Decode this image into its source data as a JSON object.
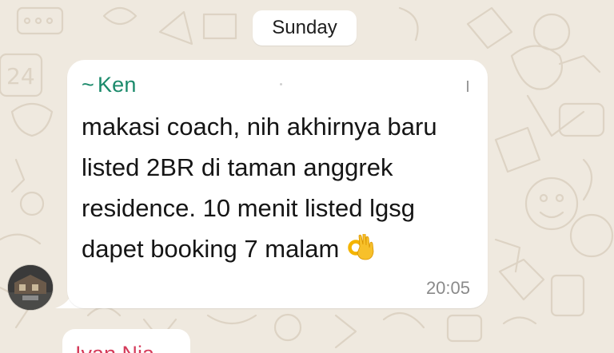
{
  "chat": {
    "date_separator": "Sunday",
    "colors": {
      "background": "#efe9df",
      "bubble": "#ffffff",
      "sender_name": "#1b8a6b",
      "next_sender_name": "#d43b5a",
      "timestamp": "#8a8a8a"
    },
    "message": {
      "sender_prefix": "~",
      "sender_name": "Ken",
      "lines": [
        "makasi coach, nih akhirnya baru",
        "listed 2BR di taman anggrek",
        "residence. 10 menit listed lgsg",
        "dapet booking 7 malam"
      ],
      "emoji": "ok-hand-icon",
      "time": "20:05"
    },
    "next_message": {
      "sender_name_partial": "Ivan Nia"
    }
  }
}
